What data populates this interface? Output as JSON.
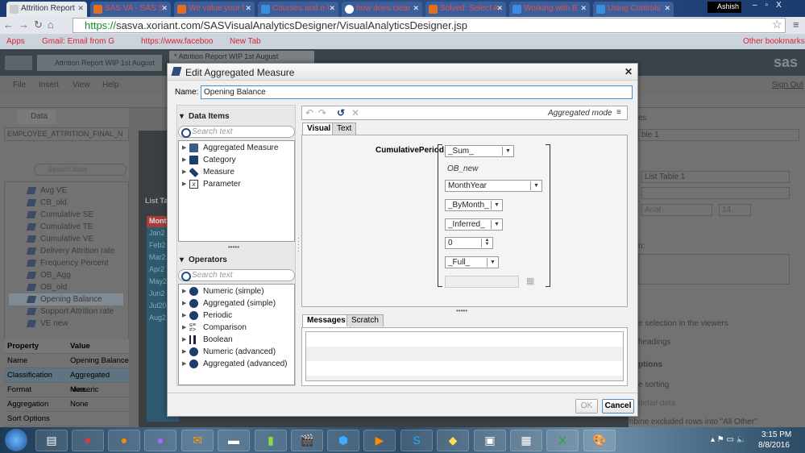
{
  "browser": {
    "tabs": [
      {
        "label": "Attrition Report",
        "active": true
      },
      {
        "label": "SAS VA - SAS S"
      },
      {
        "label": "We value your f"
      },
      {
        "label": "Courses and e-l"
      },
      {
        "label": "how does clear"
      },
      {
        "label": "Solved: Select A"
      },
      {
        "label": "Working with B"
      },
      {
        "label": "Using Controls"
      }
    ],
    "user": "Ashish",
    "url_https": "https://",
    "url_rest": "sasva.xoriant.com/SASVisualAnalyticsDesigner/VisualAnalyticsDesigner.jsp",
    "bookmarks": [
      "Apps",
      "Gmail: Email from G",
      "https://www.faceboo",
      "New Tab"
    ],
    "other_bookmarks": "Other bookmarks"
  },
  "app": {
    "tabs": [
      "Attrition Report WIP 1st August",
      "* Attrition Report WIP 1st August"
    ],
    "logo": "sas",
    "menu": [
      "File",
      "Insert",
      "View",
      "Help"
    ],
    "sign_out": "Sign Out",
    "data_tab": "Data",
    "datasource": "EMPLOYEE_ATTRITION_FINAL_N",
    "search_placeholder": "Search data",
    "data_items": [
      "Avg VE",
      "CB_old",
      "Cumulative SE",
      "Cumulative TE",
      "Cumulative VE",
      "Delivery Attrition rate",
      "Frequency Percent",
      "OB_Agg",
      "OB_old",
      "Opening Balance",
      "Support Attrition rate",
      "VE new"
    ],
    "selected_item": "Opening Balance",
    "properties": {
      "headers": [
        "Property",
        "Value"
      ],
      "rows": [
        [
          "Name",
          "Opening Balance"
        ],
        [
          "Classification",
          "Aggregated Mea..."
        ],
        [
          "Format",
          "Numeric"
        ],
        [
          "Aggregation",
          "None"
        ],
        [
          "Sort Options",
          ""
        ]
      ]
    },
    "canvas": {
      "tab": "List Ta",
      "header": "Month",
      "rows": [
        "Jan2",
        "Feb2",
        "Mar2",
        "Apr2",
        "May2",
        "Jun2",
        "Jul20",
        "Aug2"
      ]
    },
    "right_panel": {
      "tab": "es",
      "object": "ble 1",
      "title": "List Table 1",
      "font": "Arial",
      "font_size": "14",
      "label_n": "n:",
      "options": [
        "e selection in the viewers",
        "headings"
      ],
      "section": "ptions",
      "options2": [
        "e sorting",
        "detail data",
        "mbine excluded rows into \"All Other\""
      ]
    }
  },
  "dialog": {
    "title": "Edit Aggregated Measure",
    "name_label": "Name:",
    "name_value": "Opening Balance",
    "data_items_header": "Data Items",
    "search_placeholder": "Search text",
    "data_items": [
      "Aggregated Measure",
      "Category",
      "Measure",
      "Parameter"
    ],
    "operators_header": "Operators",
    "operators": [
      "Numeric (simple)",
      "Aggregated (simple)",
      "Periodic",
      "Comparison",
      "Boolean",
      "Numeric (advanced)",
      "Aggregated (advanced)"
    ],
    "mode": "Aggregated mode",
    "editor_tabs": [
      "Visual",
      "Text"
    ],
    "function": "CumulativePeriod",
    "params": {
      "agg": "_Sum_",
      "measure": "OB_new",
      "date": "MonthYear",
      "interval": "_ByMonth_",
      "type": "_Inferred_",
      "offset": "0",
      "range": "_Full_",
      "date_value": ""
    },
    "message_tabs": [
      "Messages",
      "Scratch"
    ],
    "ok": "OK",
    "cancel": "Cancel"
  },
  "taskbar": {
    "time": "3:15 PM",
    "date": "8/8/2016"
  }
}
